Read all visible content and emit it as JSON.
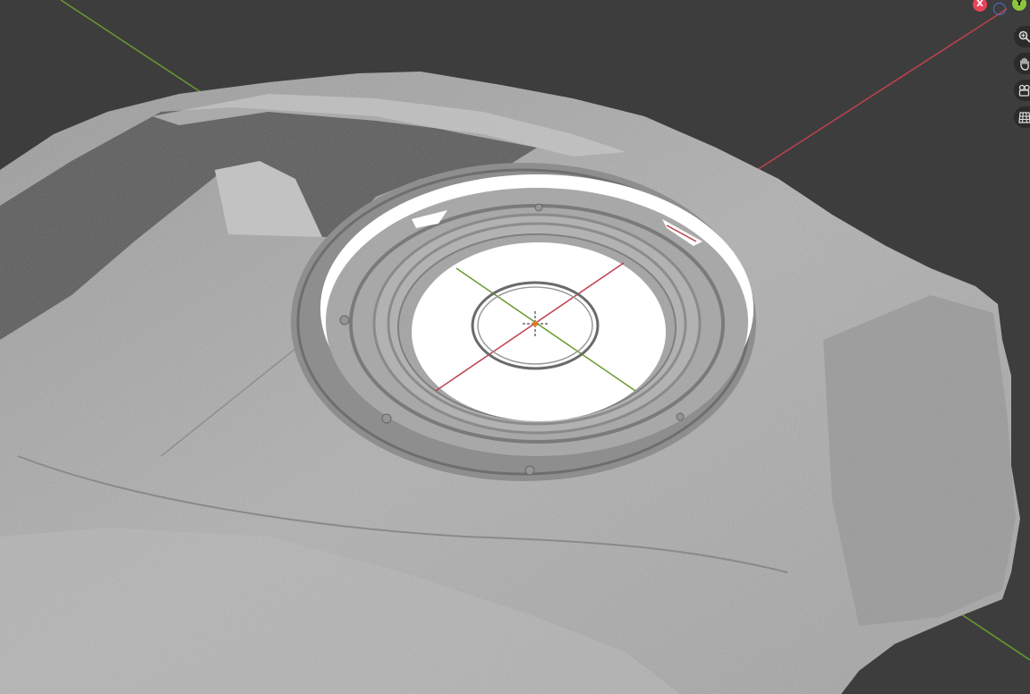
{
  "viewport": {
    "background": "#3d3d3d",
    "mesh_color": "#a9a9a9",
    "hole_color": "#ffffff",
    "axis_x_color": "#c0404f",
    "axis_y_color": "#6a9a2e"
  },
  "gizmo": {
    "x_label": "X",
    "y_label": "Y",
    "x_color": "#e8435a",
    "y_color": "#8cc63f",
    "z_color": "#4a73c9"
  },
  "nav_icons": [
    "zoom-icon",
    "hand-pan-icon",
    "camera-icon",
    "grid-icon"
  ]
}
